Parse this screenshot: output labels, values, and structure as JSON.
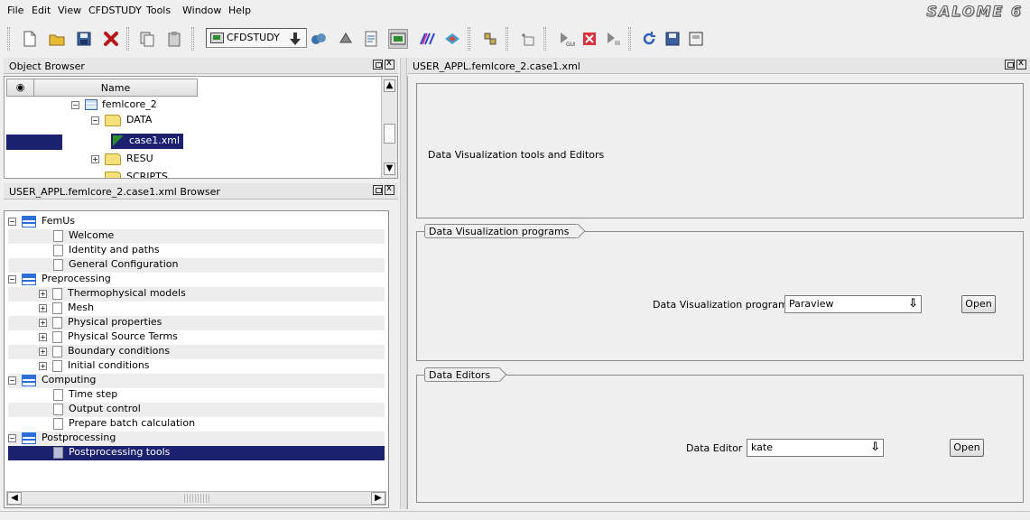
{
  "menu": {
    "file": "File",
    "edit": "Edit",
    "view": "View",
    "cfdstudy": "CFDSTUDY",
    "tools": "Tools",
    "window": "Window",
    "help": "Help"
  },
  "logo_text": "SALOME 6",
  "toolbar": {
    "module_combo_value": "CFDSTUDY"
  },
  "object_browser": {
    "title": "Object Browser",
    "header_name": "Name",
    "items": [
      {
        "label": "femlcore_2"
      },
      {
        "label": "DATA"
      },
      {
        "label": "case1.xml"
      },
      {
        "label": "RESU"
      },
      {
        "label": "SCRIPTS"
      }
    ]
  },
  "case_browser": {
    "title": "USER_APPL.femlcore_2.case1.xml Browser",
    "items": [
      {
        "label": "FemUs"
      },
      {
        "label": "Welcome"
      },
      {
        "label": "Identity and paths"
      },
      {
        "label": "General Configuration"
      },
      {
        "label": "Preprocessing"
      },
      {
        "label": "Thermophysical models"
      },
      {
        "label": "Mesh"
      },
      {
        "label": "Physical properties"
      },
      {
        "label": "Physical Source Terms"
      },
      {
        "label": "Boundary conditions"
      },
      {
        "label": "Initial conditions"
      },
      {
        "label": "Computing"
      },
      {
        "label": "Time step"
      },
      {
        "label": "Output control"
      },
      {
        "label": "Prepare batch calculation"
      },
      {
        "label": "Postprocessing"
      },
      {
        "label": "Postprocessing tools"
      }
    ]
  },
  "right_panel": {
    "title": "USER_APPL.femlcore_2.case1.xml",
    "header_text": "Data Visualization tools and Editors",
    "vis_group": {
      "title": "Data Visualization programs",
      "label": "Data Visualization program",
      "value": "Paraview",
      "button": "Open"
    },
    "editor_group": {
      "title": "Data Editors",
      "label": "Data Editor",
      "value": "kate",
      "button": "Open"
    }
  }
}
